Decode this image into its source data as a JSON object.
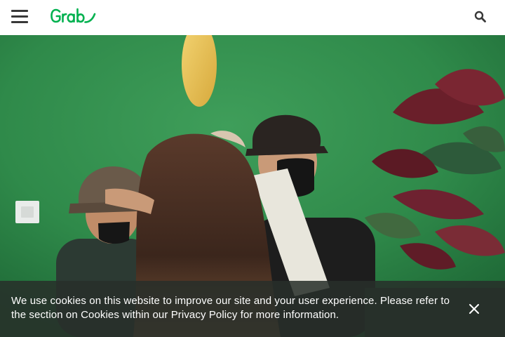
{
  "header": {
    "logo_text": "Grab",
    "menu_icon": "hamburger-menu-icon",
    "search_icon": "search-icon"
  },
  "hero": {
    "description_icon": "hero-photo"
  },
  "cookie_banner": {
    "message": "We use cookies on this website to improve our site and your user experience. Please refer to the section on Cookies within our Privacy Policy for more information.",
    "close_icon": "close-icon"
  },
  "colors": {
    "brand_green": "#00B14F",
    "header_bg": "#FFFFFF",
    "icon_dark": "#383838",
    "banner_bg": "#282E2A"
  }
}
